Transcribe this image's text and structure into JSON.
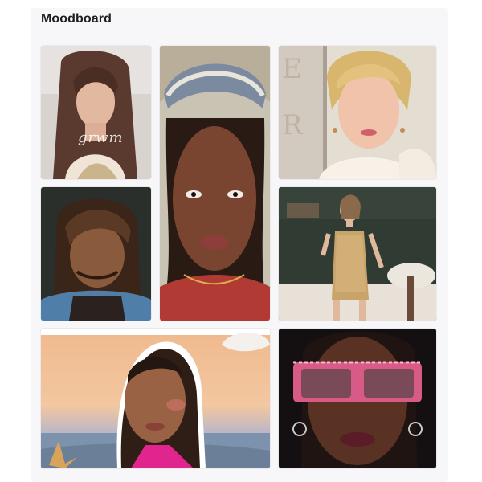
{
  "board": {
    "title": "Moodboard"
  },
  "tiles": [
    {
      "name": "grwm-portrait",
      "caption": "grwm"
    },
    {
      "name": "headscarf-closeup-portrait"
    },
    {
      "name": "blonde-red-carpet-portrait"
    },
    {
      "name": "curly-bangs-portrait"
    },
    {
      "name": "sequin-dress-party-photo"
    },
    {
      "name": "sunset-beach-portrait"
    },
    {
      "name": "pink-sunglasses-portrait"
    }
  ],
  "colors": {
    "board_background": "#f7f7f9",
    "title_text": "#1d1d1f"
  }
}
